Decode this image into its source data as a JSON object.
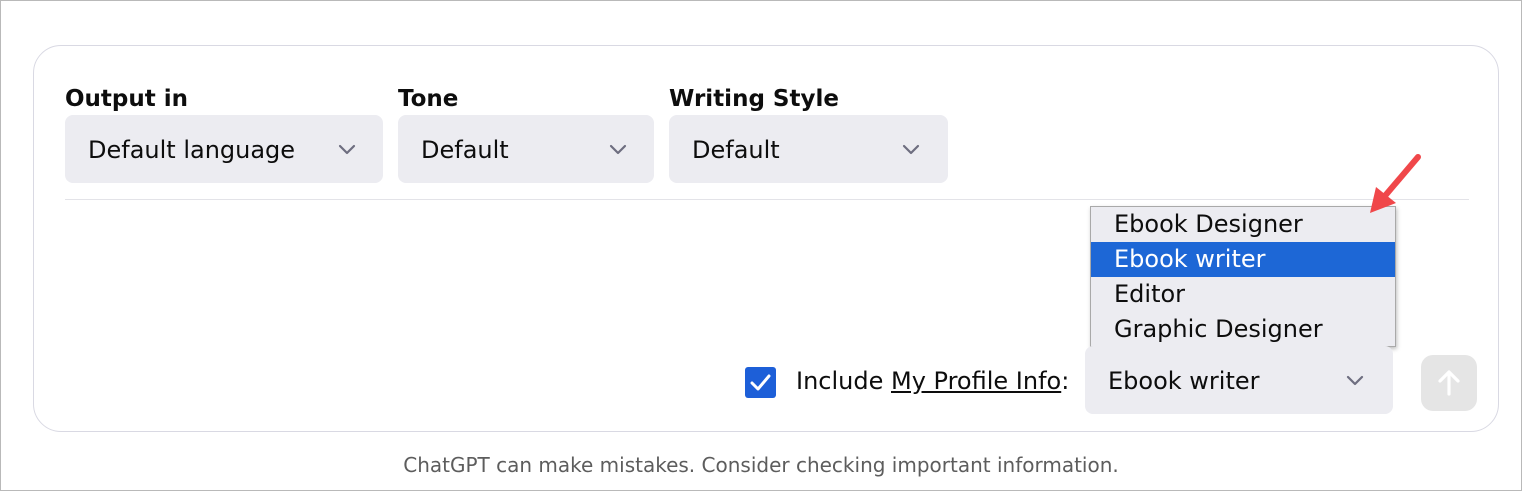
{
  "composer": {
    "output_in": {
      "label": "Output in",
      "value": "Default language"
    },
    "tone": {
      "label": "Tone",
      "value": "Default"
    },
    "writing_style": {
      "label": "Writing Style",
      "value": "Default"
    },
    "profile_dropdown": {
      "options": [
        {
          "label": "Ebook Designer",
          "selected": false
        },
        {
          "label": "Ebook writer",
          "selected": true
        },
        {
          "label": "Editor",
          "selected": false
        },
        {
          "label": "Graphic Designer",
          "selected": false
        }
      ],
      "selected_value": "Ebook writer"
    },
    "include_profile": {
      "checked": true,
      "prefix": "Include ",
      "link_text": "My Profile Info",
      "suffix": ":"
    }
  },
  "disclaimer": "ChatGPT can make mistakes. Consider checking important information.",
  "colors": {
    "select_bg": "#ececf1",
    "selected_option": "#1d67d6",
    "checkbox": "#1d5fd8",
    "annotation_arrow": "#f0474a",
    "send_button_disabled": "#e5e5e5"
  },
  "icons": {
    "chevron": "chevron-down-icon",
    "check": "check-icon",
    "send": "arrow-up-icon",
    "annotation": "red-arrow-icon"
  }
}
